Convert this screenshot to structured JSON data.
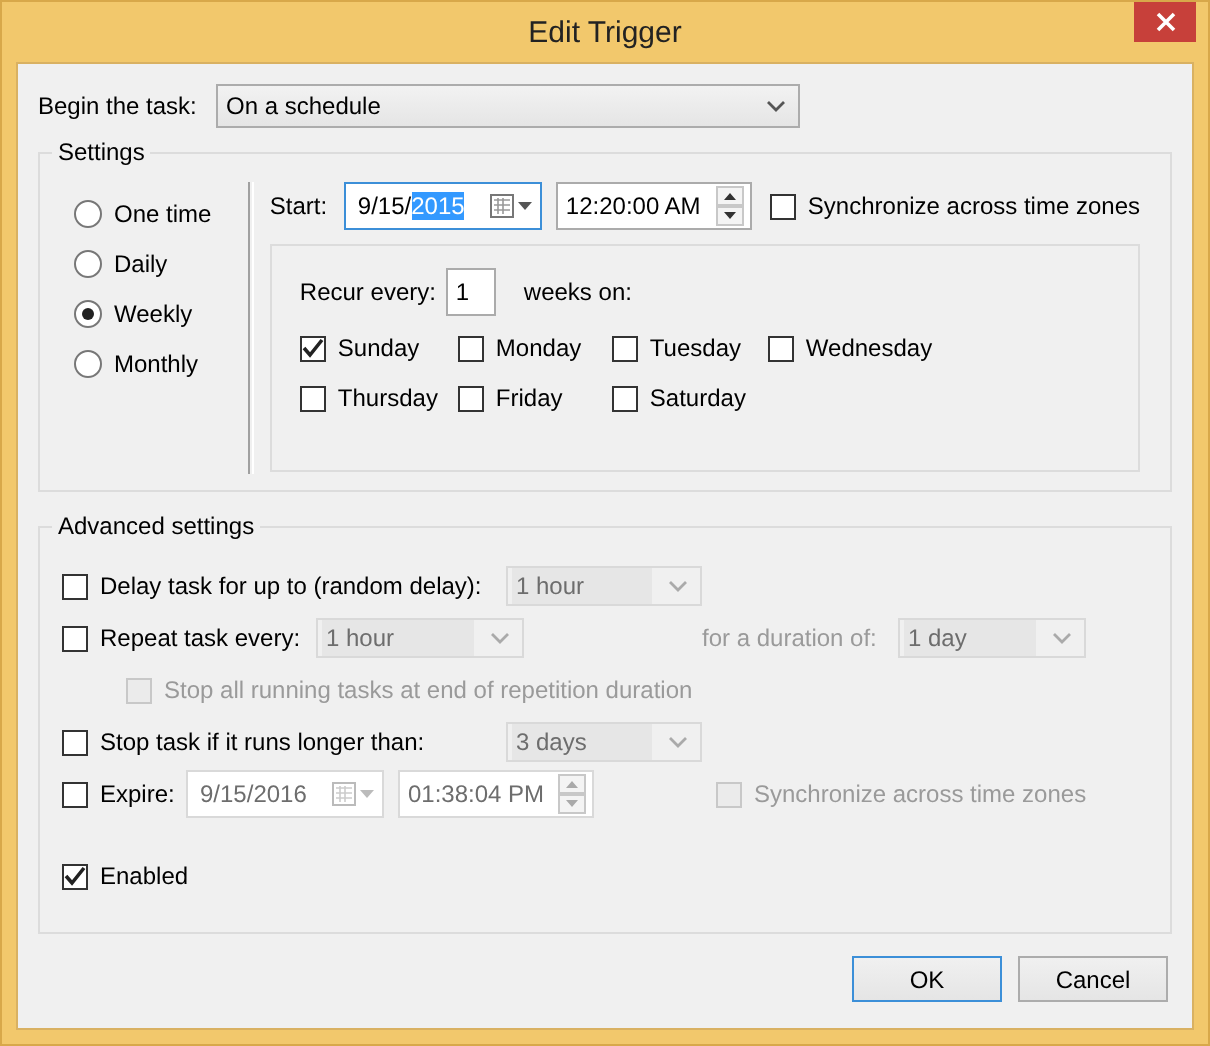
{
  "window": {
    "title": "Edit Trigger"
  },
  "begin_task": {
    "label": "Begin the task:",
    "value": "On a schedule"
  },
  "settings": {
    "title": "Settings",
    "schedules": [
      {
        "label": "One time",
        "selected": false
      },
      {
        "label": "Daily",
        "selected": false
      },
      {
        "label": "Weekly",
        "selected": true
      },
      {
        "label": "Monthly",
        "selected": false
      }
    ],
    "start": {
      "label": "Start:",
      "date_text": "9/15/",
      "date_selected_text": "2015",
      "time": "12:20:00 AM"
    },
    "sync": {
      "label": "Synchronize across time zones",
      "checked": false
    },
    "recur": {
      "label": "Recur every:",
      "value": "1",
      "unit": "weeks on:"
    },
    "days": [
      {
        "label": "Sunday",
        "checked": true
      },
      {
        "label": "Monday",
        "checked": false
      },
      {
        "label": "Tuesday",
        "checked": false
      },
      {
        "label": "Wednesday",
        "checked": false
      },
      {
        "label": "Thursday",
        "checked": false
      },
      {
        "label": "Friday",
        "checked": false
      },
      {
        "label": "Saturday",
        "checked": false
      }
    ]
  },
  "advanced": {
    "title": "Advanced settings",
    "delay": {
      "label": "Delay task for up to (random delay):",
      "checked": false,
      "value": "1 hour",
      "disabled": true
    },
    "repeat": {
      "label": "Repeat task every:",
      "checked": false,
      "value": "1 hour",
      "disabled": true,
      "duration_label": "for a duration of:",
      "duration_value": "1 day"
    },
    "stop_all": {
      "label": "Stop all running tasks at end of repetition duration",
      "checked": false,
      "disabled": true
    },
    "stop_longer": {
      "label": "Stop task if it runs longer than:",
      "checked": false,
      "value": "3 days",
      "disabled": true
    },
    "expire": {
      "label": "Expire:",
      "checked": false,
      "date": "9/15/2016",
      "time": "01:38:04 PM",
      "disabled": true
    },
    "expire_sync": {
      "label": "Synchronize across time zones",
      "checked": false,
      "disabled": true
    },
    "enabled": {
      "label": "Enabled",
      "checked": true
    }
  },
  "buttons": [
    {
      "label": "OK",
      "default": true
    },
    {
      "label": "Cancel",
      "default": false
    }
  ]
}
